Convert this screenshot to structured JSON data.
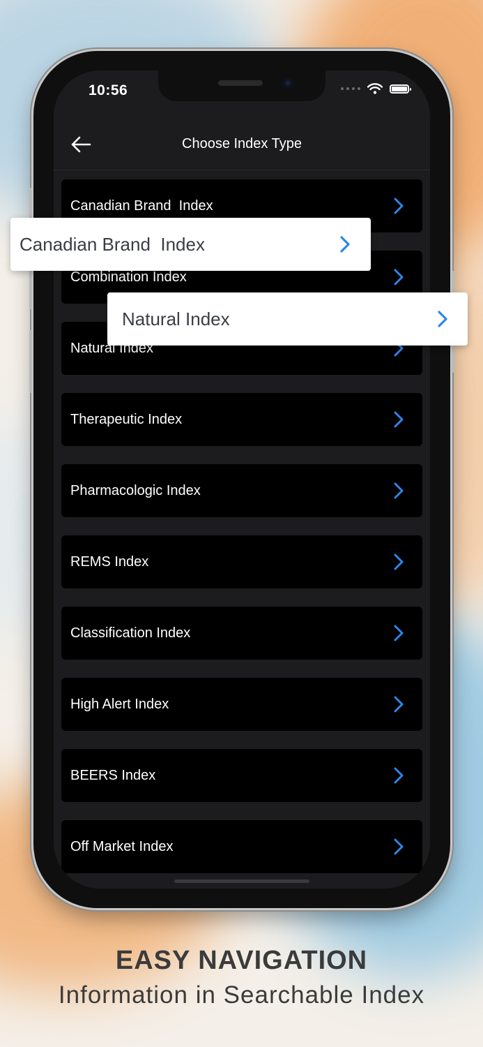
{
  "status_bar": {
    "time": "10:56"
  },
  "navbar": {
    "title": "Choose Index Type"
  },
  "index_list": [
    {
      "label": "Canadian Brand  Index"
    },
    {
      "label": "Combination Index"
    },
    {
      "label": "Natural Index"
    },
    {
      "label": "Therapeutic Index"
    },
    {
      "label": "Pharmacologic Index"
    },
    {
      "label": "REMS Index"
    },
    {
      "label": "Classification Index"
    },
    {
      "label": "High Alert Index"
    },
    {
      "label": "BEERS Index"
    },
    {
      "label": "Off Market Index"
    }
  ],
  "callouts": [
    {
      "label": "Canadian Brand  Index"
    },
    {
      "label": "Natural Index"
    }
  ],
  "caption": {
    "title": "EASY NAVIGATION",
    "subtitle": "Information in Searchable Index"
  },
  "colors": {
    "accent": "#2f86e8",
    "screen_bg": "#1c1c1e",
    "row_bg": "#000000",
    "caption_text": "#3b3b3b"
  },
  "icons": {
    "back": "back-arrow-icon",
    "chevron": "chevron-right-icon",
    "wifi": "wifi-icon",
    "battery": "battery-icon"
  }
}
